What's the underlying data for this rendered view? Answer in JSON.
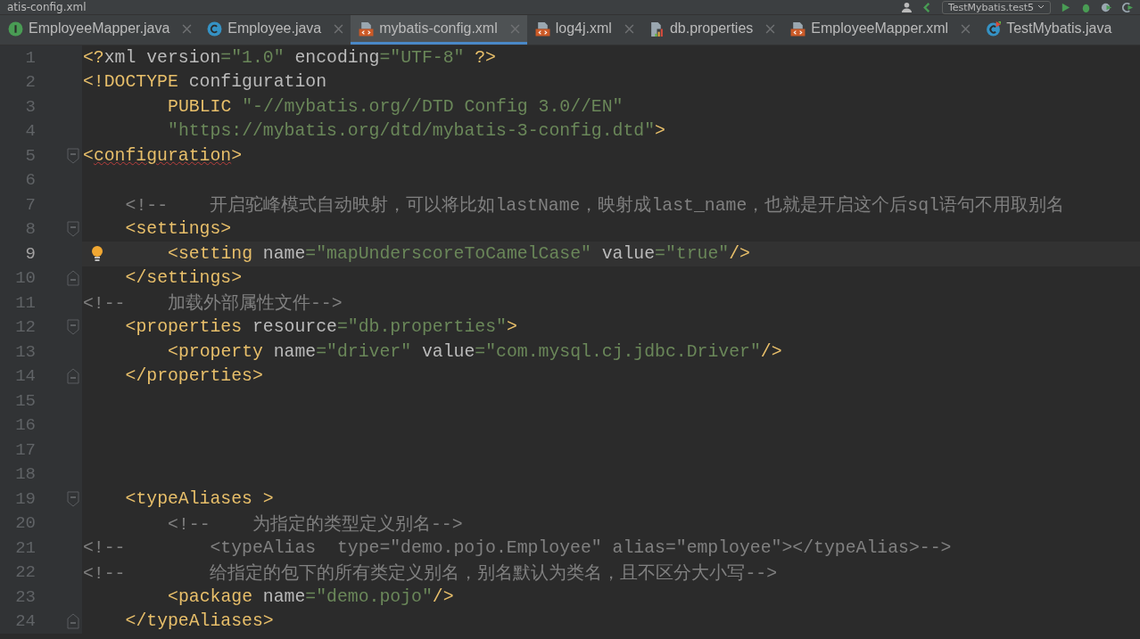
{
  "window": {
    "title": "atis-config.xml"
  },
  "toolbar": {
    "run_config": "TestMybatis.test5"
  },
  "tabs": [
    {
      "label": "EmployeeMapper.java",
      "kind": "interface",
      "selected": false,
      "closable": true
    },
    {
      "label": "Employee.java",
      "kind": "class",
      "selected": false,
      "closable": true
    },
    {
      "label": "mybatis-config.xml",
      "kind": "xml",
      "selected": true,
      "closable": true
    },
    {
      "label": "log4j.xml",
      "kind": "xml",
      "selected": false,
      "closable": true
    },
    {
      "label": "db.properties",
      "kind": "properties",
      "selected": false,
      "closable": true
    },
    {
      "label": "EmployeeMapper.xml",
      "kind": "xml",
      "selected": false,
      "closable": true
    },
    {
      "label": "TestMybatis.java",
      "kind": "test",
      "selected": false,
      "closable": false
    }
  ],
  "editor": {
    "lines": [
      {
        "number": "1",
        "kind": "plain",
        "current": false,
        "bulb": false,
        "segments": [
          {
            "kind": "tag",
            "t": "<?"
          },
          {
            "kind": "attr",
            "t": "xml version"
          },
          {
            "kind": "val",
            "t": "=\"1.0\""
          },
          {
            "kind": "attr",
            "t": " encoding"
          },
          {
            "kind": "val",
            "t": "=\"UTF-8\""
          },
          {
            "kind": "tag",
            "t": " ?>"
          }
        ]
      },
      {
        "number": "2",
        "kind": "plain",
        "current": false,
        "bulb": false,
        "segments": [
          {
            "kind": "tag",
            "t": "<!DOCTYPE"
          },
          {
            "kind": "attr",
            "t": " configuration"
          }
        ]
      },
      {
        "number": "3",
        "kind": "plain",
        "current": false,
        "bulb": false,
        "segments": [
          {
            "kind": "tag",
            "t": "        PUBLIC "
          },
          {
            "kind": "val",
            "t": "\"-//mybatis.org//DTD Config 3.0//EN\""
          }
        ]
      },
      {
        "number": "4",
        "kind": "plain",
        "current": false,
        "bulb": false,
        "segments": [
          {
            "kind": "val",
            "t": "        \"https://mybatis.org/dtd/mybatis-3-config.dtd\""
          },
          {
            "kind": "tag",
            "t": ">"
          }
        ]
      },
      {
        "number": "5",
        "kind": "start",
        "current": false,
        "bulb": false,
        "segments": [
          {
            "kind": "tag",
            "t": "<"
          },
          {
            "kind": "error",
            "t": "configuration"
          },
          {
            "kind": "tag",
            "t": ">"
          }
        ]
      },
      {
        "number": "6",
        "kind": "plain",
        "current": false,
        "bulb": false
      },
      {
        "number": "7",
        "kind": "plain",
        "current": false,
        "bulb": false,
        "segments": [
          {
            "kind": "comment",
            "t": "    <!--    开启驼峰模式自动映射，可以将比如lastName，映射成last_name，也就是开启这个后sql语句不用取别名"
          }
        ]
      },
      {
        "number": "8",
        "kind": "start",
        "current": false,
        "bulb": false,
        "segments": [
          {
            "kind": "tag",
            "t": "    <settings>"
          }
        ]
      },
      {
        "number": "9",
        "kind": "plain",
        "current": true,
        "bulb": true,
        "segments": [
          {
            "kind": "tag",
            "t": "        <setting"
          },
          {
            "kind": "attr",
            "t": " name"
          },
          {
            "kind": "val",
            "t": "=\"mapUnderscoreToCamelCase\""
          },
          {
            "kind": "attr",
            "t": " value"
          },
          {
            "kind": "val",
            "t": "=\"true\""
          },
          {
            "kind": "tag",
            "t": "/>"
          }
        ]
      },
      {
        "number": "10",
        "kind": "end",
        "current": false,
        "bulb": false,
        "segments": [
          {
            "kind": "tag",
            "t": "    </settings>"
          }
        ]
      },
      {
        "number": "11",
        "kind": "plain",
        "current": false,
        "bulb": false,
        "segments": [
          {
            "kind": "comment",
            "t": "<!--    加载外部属性文件-->"
          }
        ]
      },
      {
        "number": "12",
        "kind": "start",
        "current": false,
        "bulb": false,
        "segments": [
          {
            "kind": "tag",
            "t": "    <properties"
          },
          {
            "kind": "attr",
            "t": " resource"
          },
          {
            "kind": "val",
            "t": "=\"db.properties\""
          },
          {
            "kind": "tag",
            "t": ">"
          }
        ]
      },
      {
        "number": "13",
        "kind": "plain",
        "current": false,
        "bulb": false,
        "segments": [
          {
            "kind": "tag",
            "t": "        <property"
          },
          {
            "kind": "attr",
            "t": " name"
          },
          {
            "kind": "val",
            "t": "=\"driver\""
          },
          {
            "kind": "attr",
            "t": " value"
          },
          {
            "kind": "val",
            "t": "=\"com.mysql.cj.jdbc.Driver\""
          },
          {
            "kind": "tag",
            "t": "/>"
          }
        ]
      },
      {
        "number": "14",
        "kind": "end",
        "current": false,
        "bulb": false,
        "segments": [
          {
            "kind": "tag",
            "t": "    </properties>"
          }
        ]
      },
      {
        "number": "15",
        "kind": "plain",
        "current": false,
        "bulb": false
      },
      {
        "number": "16",
        "kind": "plain",
        "current": false,
        "bulb": false
      },
      {
        "number": "17",
        "kind": "plain",
        "current": false,
        "bulb": false
      },
      {
        "number": "18",
        "kind": "plain",
        "current": false,
        "bulb": false
      },
      {
        "number": "19",
        "kind": "start",
        "current": false,
        "bulb": false,
        "segments": [
          {
            "kind": "tag",
            "t": "    <typeAliases >"
          }
        ]
      },
      {
        "number": "20",
        "kind": "plain",
        "current": false,
        "bulb": false,
        "segments": [
          {
            "kind": "comment",
            "t": "        <!--    为指定的类型定义别名-->"
          }
        ]
      },
      {
        "number": "21",
        "kind": "plain",
        "current": false,
        "bulb": false,
        "segments": [
          {
            "kind": "comment",
            "t": "<!--        <typeAlias  type=\"demo.pojo.Employee\" alias=\"employee\"></typeAlias>-->"
          }
        ]
      },
      {
        "number": "22",
        "kind": "plain",
        "current": false,
        "bulb": false,
        "segments": [
          {
            "kind": "comment",
            "t": "<!--        给指定的包下的所有类定义别名，别名默认为类名，且不区分大小写-->"
          }
        ]
      },
      {
        "number": "23",
        "kind": "plain",
        "current": false,
        "bulb": false,
        "segments": [
          {
            "kind": "tag",
            "t": "        <package"
          },
          {
            "kind": "attr",
            "t": " name"
          },
          {
            "kind": "val",
            "t": "=\"demo.pojo\""
          },
          {
            "kind": "tag",
            "t": "/>"
          }
        ]
      },
      {
        "number": "24",
        "kind": "end",
        "current": false,
        "bulb": false,
        "segments": [
          {
            "kind": "tag",
            "t": "    </typeAliases>"
          }
        ]
      }
    ]
  }
}
